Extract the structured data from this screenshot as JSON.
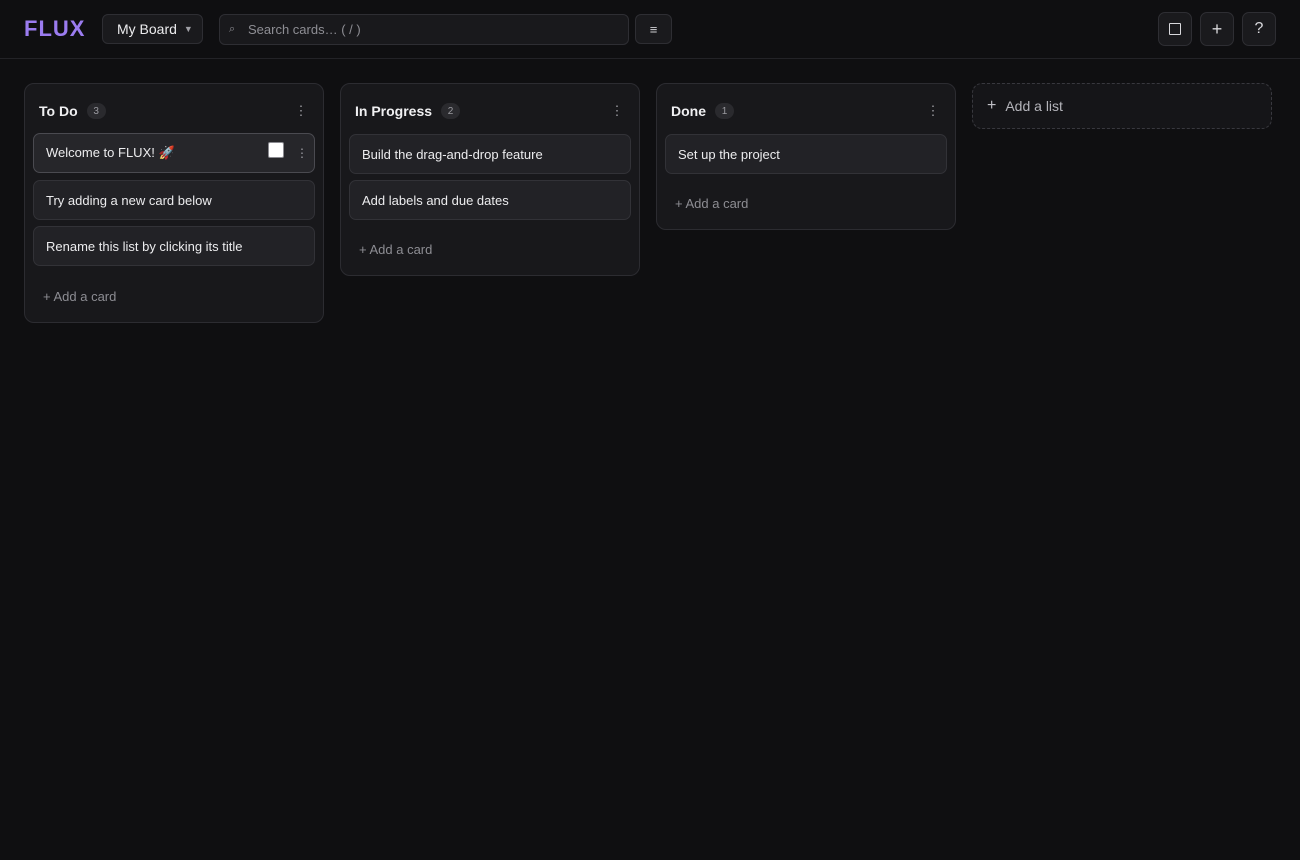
{
  "app": {
    "logo": "FLUX"
  },
  "header": {
    "board_name": "My Board",
    "search_placeholder": "Search cards… ( / )",
    "search_value": "",
    "filter_icon": "≡",
    "actions": [
      {
        "name": "square-icon",
        "glyph": ""
      },
      {
        "name": "plus-icon",
        "glyph": "+"
      },
      {
        "name": "help-icon",
        "glyph": "?"
      }
    ]
  },
  "lists": [
    {
      "title": "To Do",
      "count": "3",
      "cards": [
        "Welcome to FLUX! 🚀",
        "Try adding a new card below",
        "Rename this list by clicking its title"
      ],
      "add_card_label": "+ Add a card"
    },
    {
      "title": "In Progress",
      "count": "2",
      "cards": [
        "Build the drag-and-drop feature",
        "Add labels and due dates"
      ],
      "add_card_label": "+ Add a card"
    },
    {
      "title": "Done",
      "count": "1",
      "cards": [
        "Set up the project"
      ],
      "add_card_label": "+ Add a card"
    }
  ],
  "add_list": {
    "plus": "+",
    "label": "Add a list"
  },
  "colors": {
    "accent": "#9b7cf0",
    "background": "#0f0f11",
    "card": "#222226"
  }
}
